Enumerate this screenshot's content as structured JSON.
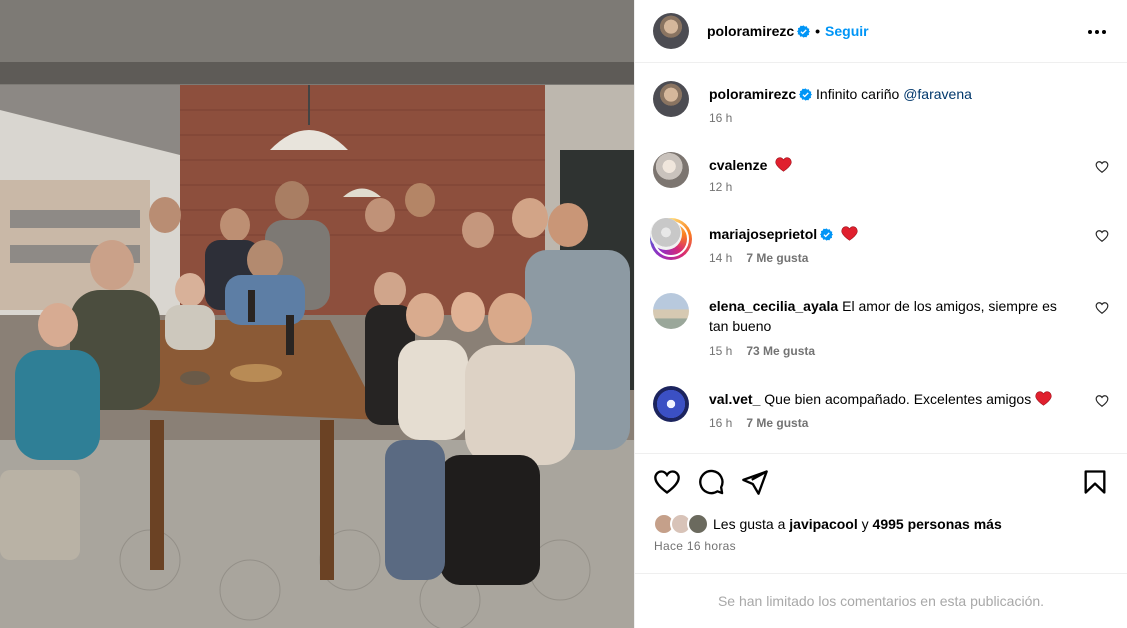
{
  "post": {
    "photo_alt": "Grupo de amigos reunidos alrededor de una mesa"
  },
  "header": {
    "username": "poloramirezc",
    "separator": "•",
    "follow_label": "Seguir"
  },
  "caption": {
    "username": "poloramirezc",
    "text": "Infinito cariño",
    "mention": "@faravena",
    "time": "16 h"
  },
  "comments": [
    {
      "username": "cvalenze",
      "text": "",
      "emoji": "red-heart",
      "time": "12 h",
      "likes": ""
    },
    {
      "username": "mariajoseprietol",
      "text": "",
      "emoji": "red-heart",
      "time": "14 h",
      "likes": "7 Me gusta",
      "verified": true
    },
    {
      "username": "elena_cecilia_ayala",
      "text": "El amor de los amigos, siempre es tan bueno",
      "emoji": "",
      "time": "15 h",
      "likes": "73 Me gusta"
    },
    {
      "username": "val.vet_",
      "text": "Que bien acompañado. Excelentes amigos",
      "emoji": "red-heart",
      "time": "16 h",
      "likes": "7 Me gusta"
    }
  ],
  "likes": {
    "prefix": "Les gusta a",
    "user": "javipacool",
    "connector": "y",
    "others": "4995 personas más"
  },
  "timestamp": "Hace 16 horas",
  "comments_limited": "Se han limitado los comentarios en esta publicación.",
  "colors": {
    "accent": "#0095f6",
    "verified": "#0095f6",
    "heart": "#ed4956",
    "muted": "#737373",
    "border": "#efefef"
  },
  "icons": [
    "heart-icon",
    "comment-icon",
    "share-icon",
    "save-icon",
    "more-options-icon",
    "verified-icon"
  ]
}
